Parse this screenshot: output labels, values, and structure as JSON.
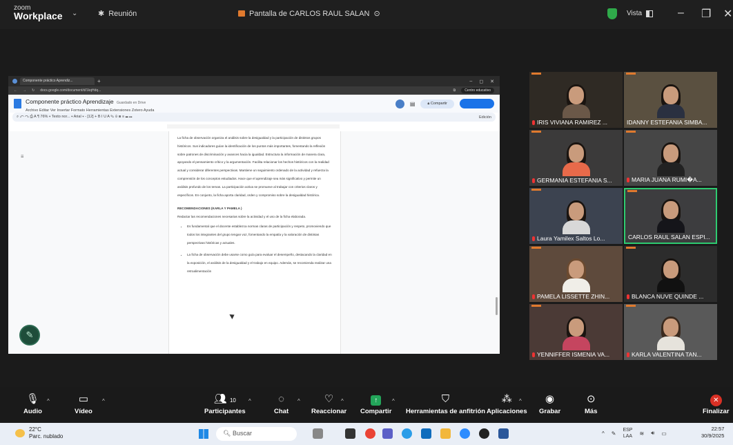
{
  "app": {
    "brand_small": "zoom",
    "brand": "Workplace",
    "meeting": "Reunión",
    "share_title": "Pantalla de CARLOS RAUL SALAN",
    "view": "Vista"
  },
  "browser": {
    "tab": "Componente práctico Aprendiz...",
    "url": "docs.google.com/document/d/1kqHdq...",
    "profile": "Centro educativo"
  },
  "doc": {
    "title": "Componente práctico Aprendizaje",
    "saved": "Guardado en Drive",
    "menu": "Archivo  Editar  Ver  Insertar  Formato  Herramientas  Extensiones  Zotero  Ayuda",
    "share": "Compartir",
    "toolbar": "⌕  ↶  ↷  ⎙  A  ¶  76%  ▾   Texto nor...  ▾   Arial  ▾   -  [12]  +   B  I  U  A  ✎   ⊝  ⊞  ≡  ☰  ☷",
    "editing": "Edición",
    "para1": "La ficha de observación organiza el análisis sobre la desigualdad y la participación de distintos grupos históricos. Sus indicadores guían la identificación de los puntos más importantes, fomentando la reflexión sobre patrones de discriminación y avances hacia la igualdad. Estructura la información de manera clara, apoyando el pensamiento crítico y la argumentación. Facilita relacionar los hechos históricos con la realidad actual y considerar diferentes perspectivas. Mantiene un seguimiento ordenado de la actividad y refuerza la comprensión de los conceptos estudiados. Hace que el aprendizaje sea más significativo y permite un análisis profundo de los temas. La participación activa se promueve al trabajar con criterios claros y específicos. En conjunto, la ficha aporta claridad, orden y compromiso sobre la desigualdad histórica.",
    "rec_heading": "RECOMENDACIONES (KARLA Y PAMELA )",
    "rec_intro": "Redactar las recomendaciones necesarias sobre la actividad y el uso de la ficha elaborada.",
    "bullet1": "Es fundamental que el docente establezca normas claras de participación y respeto, promoviendo que todos los integrantes del grupo tengan voz, fomentando la empatía y la valoración de distintas perspectivas históricas y actuales.",
    "bullet2": "La ficha de observación debe usarse como guía para evaluar el desempeño, destacando la claridad en la exposición, el análisis de la desigualdad y el trabajo en equipo. Además, se recomienda realizar una retroalimentación"
  },
  "participants": [
    {
      "name": "IRIS VIVIANA RAMIREZ ..."
    },
    {
      "name": "IDANNY ESTEFANIA SIMBA..."
    },
    {
      "name": "GERMANIA ESTEFANIA S..."
    },
    {
      "name": "MARIA JUANA RUMI�A..."
    },
    {
      "name": "Laura Yamilex Saltos Lo..."
    },
    {
      "name": "CARLOS RAUL SALAN ESPI..."
    },
    {
      "name": "PAMELA LISSETTE ZHIN..."
    },
    {
      "name": "BLANCA NUVE QUINDE ..."
    },
    {
      "name": "YENNIFFER ISMENIA VA..."
    },
    {
      "name": "KARLA VALENTINA TAN..."
    }
  ],
  "controls": {
    "audio": "Audio",
    "video": "Vídeo",
    "participants": "Participantes",
    "participants_count": "10",
    "chat": "Chat",
    "react": "Reaccionar",
    "share": "Compartir",
    "host_tools": "Herramientas de anfitrión",
    "apps": "Aplicaciones",
    "record": "Grabar",
    "more": "Más",
    "end": "Finalizar"
  },
  "taskbar": {
    "temp": "22°C",
    "weather": "Parc. nublado",
    "search": "Buscar",
    "lang1": "ESP",
    "lang2": "LAA",
    "time": "22:57",
    "date": "30/9/2025"
  }
}
